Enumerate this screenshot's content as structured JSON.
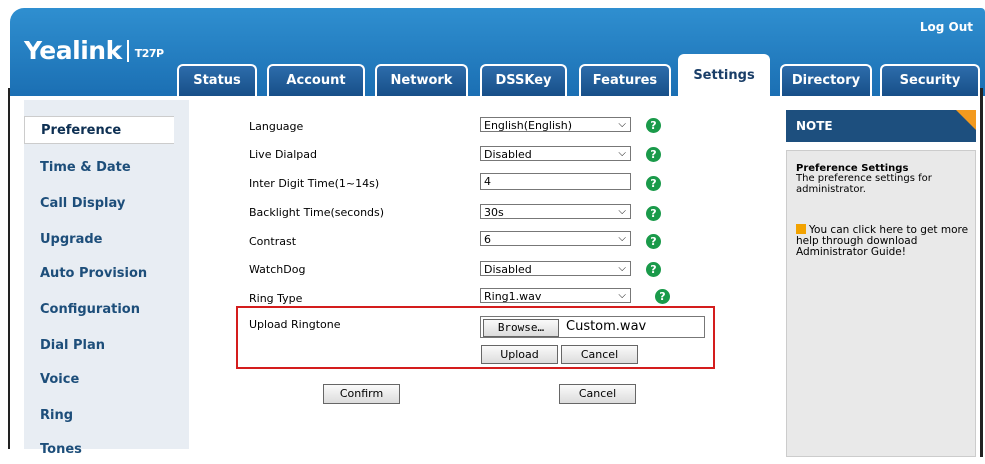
{
  "header": {
    "logo_name": "Yealink",
    "logo_model": "T27P",
    "logout": "Log Out"
  },
  "tabs": [
    "Status",
    "Account",
    "Network",
    "DSSKey",
    "Features",
    "Settings",
    "Directory",
    "Security"
  ],
  "active_tab": "Settings",
  "sidebar": {
    "items": [
      "Preference",
      "Time & Date",
      "Call Display",
      "Upgrade",
      "Auto Provision",
      "Configuration",
      "Dial Plan",
      "Voice",
      "Ring",
      "Tones"
    ],
    "active": "Preference"
  },
  "form": {
    "language": {
      "label": "Language",
      "value": "English(English)"
    },
    "live_dialpad": {
      "label": "Live Dialpad",
      "value": "Disabled"
    },
    "inter_digit": {
      "label": "Inter Digit Time(1~14s)",
      "value": "4"
    },
    "backlight": {
      "label": "Backlight Time(seconds)",
      "value": "30s"
    },
    "contrast": {
      "label": "Contrast",
      "value": "6"
    },
    "watchdog": {
      "label": "WatchDog",
      "value": "Disabled"
    },
    "ring_type": {
      "label": "Ring Type",
      "value": "Ring1.wav"
    },
    "upload_ringtone": {
      "label": "Upload Ringtone",
      "browse": "Browse…",
      "filename": "Custom.wav",
      "upload": "Upload",
      "cancel": "Cancel"
    },
    "confirm": "Confirm",
    "cancel": "Cancel"
  },
  "note": {
    "heading": "NOTE",
    "title": "Preference Settings",
    "text": "The preference settings for administrator.",
    "help": "You can click here to get more help through download Administrator Guide!"
  },
  "colors": {
    "header_blue": "#1b6fb3",
    "tab_dark": "#174f88",
    "help_green": "#1a9a4a",
    "highlight_red": "#d41d1d",
    "note_orange": "#f39a1e"
  }
}
